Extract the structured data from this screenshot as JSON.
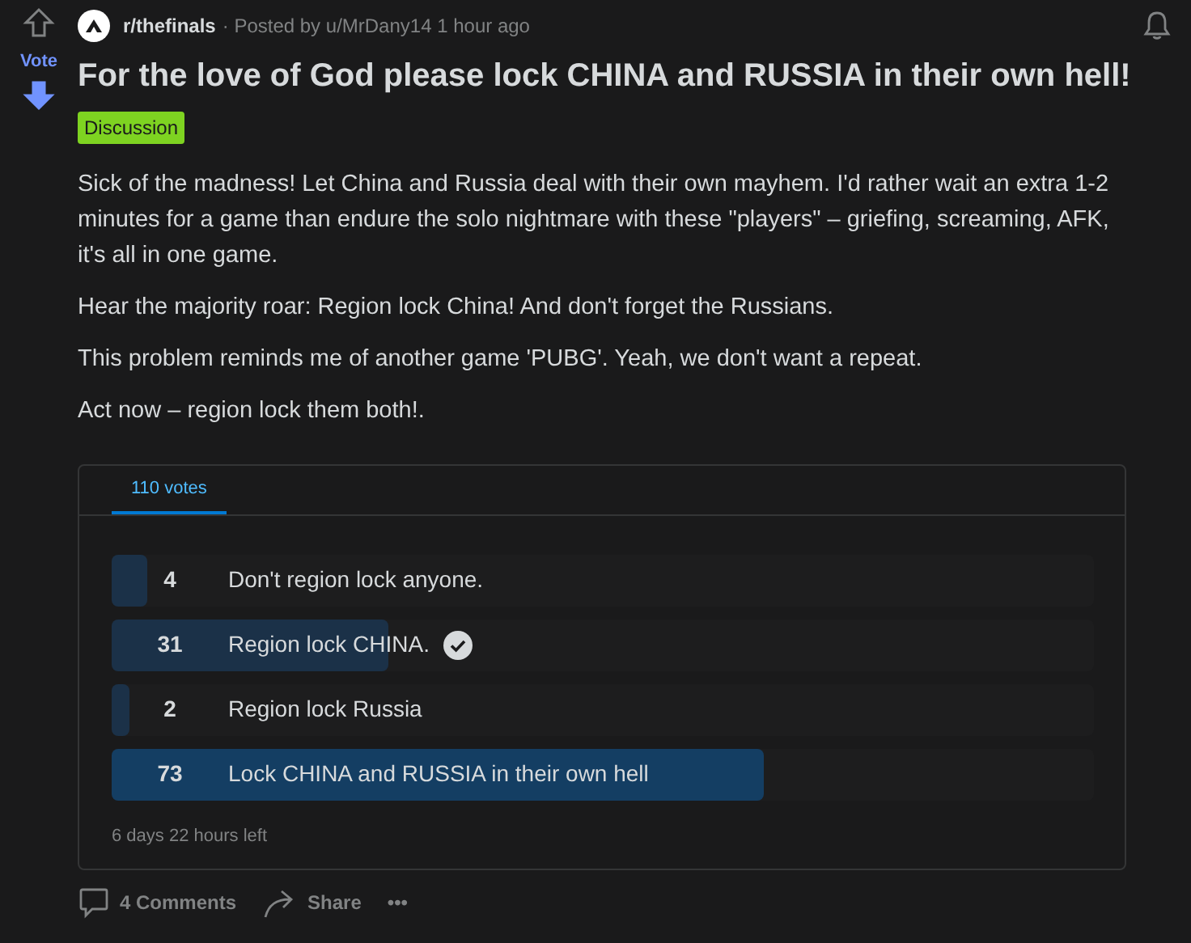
{
  "post": {
    "subreddit": "r/thefinals",
    "posted_by": "· Posted by u/MrDany14 1 hour ago",
    "vote_label": "Vote",
    "downvoted": true,
    "title": "For the love of God please lock CHINA and RUSSIA in their own hell!",
    "flair": "Discussion",
    "body": [
      "Sick of the madness! Let China and Russia deal with their own mayhem. I'd rather wait an extra 1-2 minutes for a game than endure the solo nightmare with these \"players\" – griefing, screaming, AFK, it's all in one game.",
      "Hear the majority roar: Region lock China! And don't forget the Russians.",
      "This problem reminds me of another game 'PUBG'. Yeah, we don't want a repeat.",
      "Act now – region lock them both!."
    ]
  },
  "poll": {
    "tab": "110 votes",
    "time_left": "6 days 22 hours left",
    "options": [
      {
        "count": "4",
        "label": "Don't region lock anyone.",
        "level": 0.036,
        "selected": false
      },
      {
        "count": "31",
        "label": "Region lock CHINA.",
        "level": 0.282,
        "selected": true
      },
      {
        "count": "2",
        "label": "Region lock Russia",
        "level": 0.018,
        "selected": false
      },
      {
        "count": "73",
        "label": "Lock CHINA and RUSSIA in their own hell",
        "level": 0.664,
        "selected": false
      }
    ]
  },
  "actions": {
    "comments": "4 Comments",
    "share": "Share",
    "more": "•••"
  }
}
